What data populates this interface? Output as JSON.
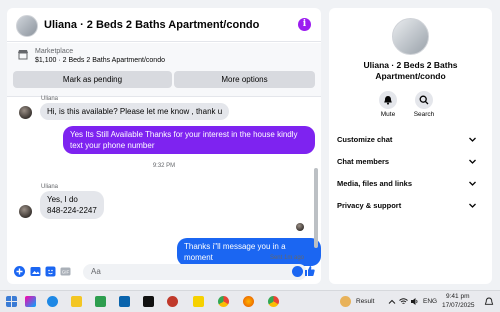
{
  "chat": {
    "title": "Uliana · 2 Beds 2 Baths Apartment/condo",
    "marketplace_label": "Marketplace",
    "listing": "$1,100 · 2 Beds 2 Baths Apartment/condo",
    "mark_pending_label": "Mark as pending",
    "more_options_label": "More options",
    "messages": [
      {
        "sender": "Uliana",
        "text": "Hi, is this available? Please let me know , thank u"
      },
      {
        "text": "Yes Its Still Available Thanks for your interest in the house kindly text your phone number"
      },
      {
        "timestamp": "9:32 PM"
      },
      {
        "sender": "Uliana",
        "text": "Yes, I do\n848-224-2247"
      },
      {
        "text": "Thanks i\"ll message you in a moment"
      }
    ],
    "sent_status": "Sent 1m ago",
    "input_placeholder": "Aa"
  },
  "info": {
    "name": "Uliana · 2 Beds 2 Baths Apartment/condo",
    "mute_label": "Mute",
    "search_label": "Search",
    "sections": [
      "Customize chat",
      "Chat members",
      "Media, files and links",
      "Privacy & support"
    ]
  },
  "taskbar": {
    "result_label": "Result",
    "language": "ENG",
    "time": "9:41 pm",
    "date": "17/07/2025"
  },
  "colors": {
    "accent_purple": "#9c1cf0",
    "outgoing_purple": "#7e23f0",
    "outgoing_blue": "#1b66f2",
    "incoming_gray": "#e4e6eb"
  }
}
